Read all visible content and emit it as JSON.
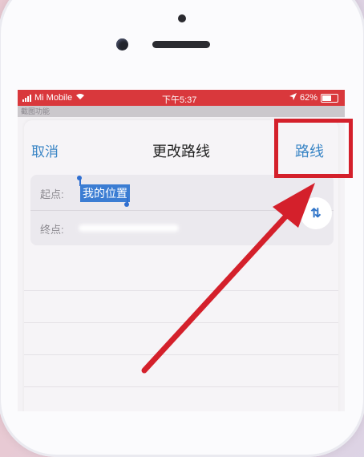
{
  "status_bar": {
    "carrier": "Mi Mobile",
    "time": "下午5:37",
    "battery": "62%"
  },
  "top_strip": {
    "text": "截图功能"
  },
  "nav": {
    "cancel_label": "取消",
    "title": "更改路线",
    "route_label": "路线"
  },
  "fields": {
    "start_label": "起点:",
    "start_value": "我的位置",
    "end_label": "终点:"
  },
  "icons": {
    "swap": "swap-arrows-icon",
    "wifi": "wifi-icon",
    "location": "location-arrow-icon",
    "battery": "battery-icon"
  },
  "colors": {
    "status_bar": "#d9383c",
    "accent": "#3b86c6",
    "annotation": "#d4202b",
    "selection": "#3b7dd3"
  }
}
